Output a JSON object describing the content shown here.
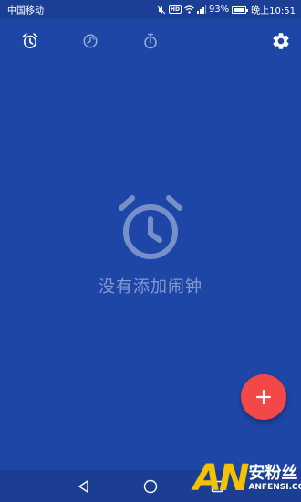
{
  "status_bar": {
    "carrier": "中国移动",
    "battery": "93%",
    "battery_level": 0.93,
    "time": "晚上10:51"
  },
  "toolbar": {
    "tabs": [
      {
        "icon": "alarm-clock-icon",
        "active": true
      },
      {
        "icon": "world-clock-icon",
        "active": false
      },
      {
        "icon": "stopwatch-icon",
        "active": false
      }
    ],
    "settings_icon": "gear-icon"
  },
  "empty_state": {
    "icon": "alarm-clock-icon",
    "message": "没有添加闹钟"
  },
  "fab": {
    "icon": "plus-icon",
    "color": "#f24848"
  },
  "nav_bar": {
    "back_icon": "back-triangle-icon",
    "home_icon": "home-circle-icon",
    "recent_icon": "recent-square-icon"
  },
  "watermark": {
    "logo": "AN",
    "name_cn": "安粉丝",
    "name_en": "ANFENSI.COM"
  },
  "colors": {
    "background": "#1e46a6",
    "status_bar": "#1c3f96",
    "accent": "#f24848"
  }
}
